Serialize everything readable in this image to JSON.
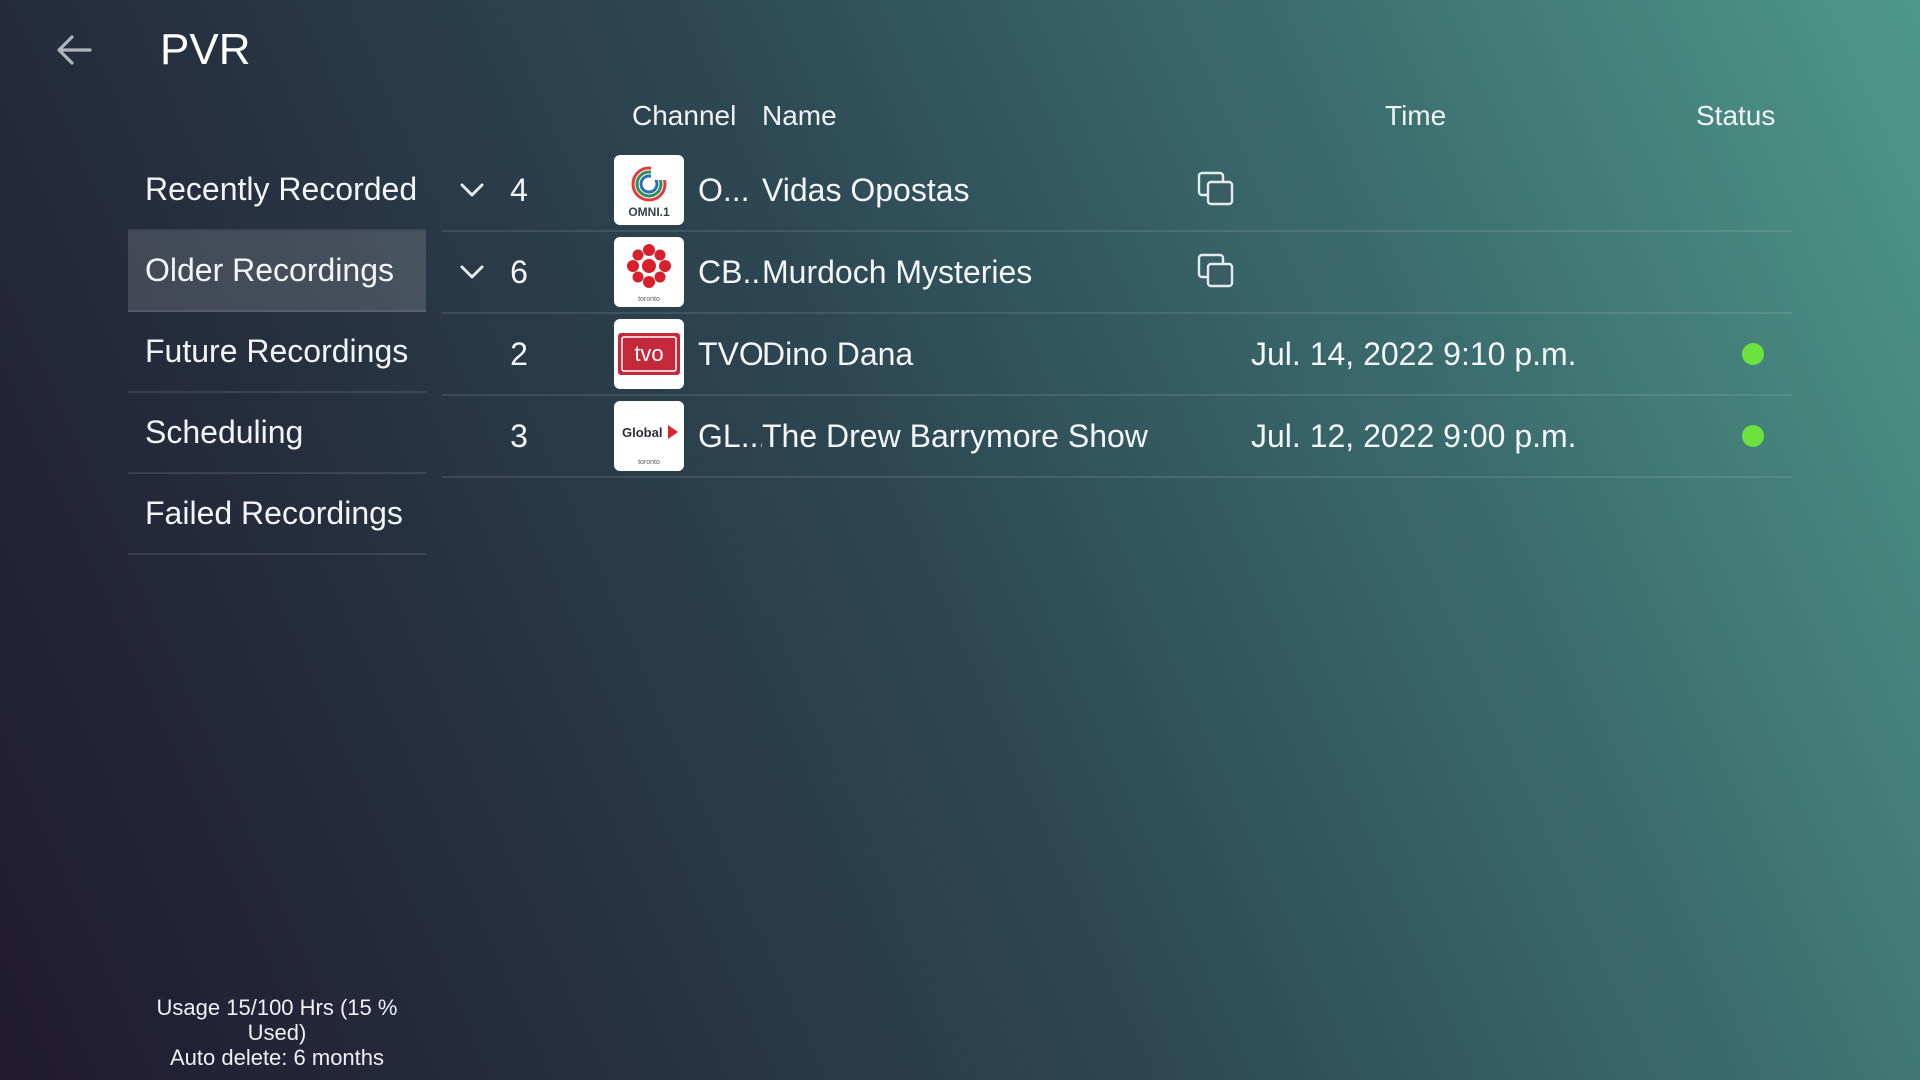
{
  "header": {
    "title": "PVR",
    "back_icon": "arrow-left-icon"
  },
  "sidebar": {
    "items": [
      {
        "label": "Recently Recorded",
        "selected": false
      },
      {
        "label": "Older Recordings",
        "selected": true
      },
      {
        "label": "Future Recordings",
        "selected": false
      },
      {
        "label": "Scheduling",
        "selected": false
      },
      {
        "label": "Failed Recordings",
        "selected": false
      }
    ]
  },
  "table": {
    "columns": {
      "channel": "Channel",
      "name": "Name",
      "time": "Time",
      "status": "Status"
    },
    "rows": [
      {
        "expandable": true,
        "count": "4",
        "channel_short": "O...",
        "logo": {
          "text": "OMNI.1",
          "sub": ""
        },
        "name": "Vidas Opostas",
        "has_copy_icon": true,
        "time": "",
        "status": null
      },
      {
        "expandable": true,
        "count": "6",
        "channel_short": "CB...",
        "logo": {
          "text": "",
          "sub": "toronto"
        },
        "name": "Murdoch Mysteries",
        "has_copy_icon": true,
        "time": "",
        "status": null
      },
      {
        "expandable": false,
        "count": "2",
        "channel_short": "TVO",
        "logo": {
          "text": "tvo",
          "sub": ""
        },
        "name": "Dino Dana",
        "has_copy_icon": false,
        "time": "Jul. 14, 2022 9:10 p.m.",
        "status": "active"
      },
      {
        "expandable": false,
        "count": "3",
        "channel_short": "GL...",
        "logo": {
          "text": "Global",
          "sub": "toronto"
        },
        "name": "The Drew Barrymore Show",
        "has_copy_icon": false,
        "time": "Jul. 12, 2022 9:00 p.m.",
        "status": "active"
      }
    ]
  },
  "footer": {
    "usage": "Usage 15/100 Hrs (15 % Used)",
    "auto_delete": "Auto delete: 6 months"
  },
  "colors": {
    "status_active": "#6de23e",
    "tvo_red": "#c4283b",
    "cbc_red": "#d8202c",
    "global_red": "#d9262a",
    "omni_green": "#2f8f5a"
  }
}
